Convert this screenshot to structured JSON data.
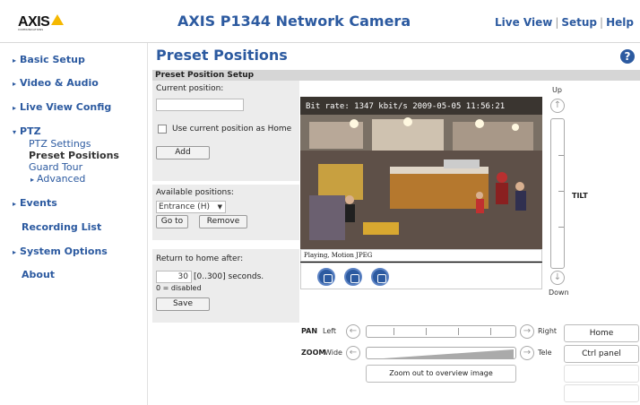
{
  "header": {
    "logo_text": "AXIS",
    "logo_sub": "COMMUNICATIONS",
    "title": "AXIS P1344 Network Camera",
    "links": [
      "Live View",
      "Setup",
      "Help"
    ],
    "sep": "|"
  },
  "sidebar": {
    "items": [
      {
        "label": "Basic Setup",
        "arrow": "▸"
      },
      {
        "label": "Video & Audio",
        "arrow": "▸"
      },
      {
        "label": "Live View Config",
        "arrow": "▸"
      },
      {
        "label": "PTZ",
        "arrow": "▾"
      },
      {
        "label": "Events",
        "arrow": "▸"
      },
      {
        "label": "Recording List",
        "arrow": ""
      },
      {
        "label": "System Options",
        "arrow": "▸"
      },
      {
        "label": "About",
        "arrow": ""
      }
    ],
    "ptz_sub": [
      "PTZ Settings",
      "Preset Positions",
      "Guard Tour",
      "Advanced"
    ],
    "advanced_arrow": "▸"
  },
  "main": {
    "title": "Preset Positions",
    "help": "?",
    "section": "Preset Position Setup",
    "current_label": "Current position:",
    "current_value": "",
    "use_home_label": "Use current position as Home",
    "add_btn": "Add",
    "available_label": "Available positions:",
    "available_selected": "Entrance (H)",
    "goto_btn": "Go to",
    "remove_btn": "Remove",
    "return_label": "Return to home after:",
    "return_value": "30",
    "return_range": "[0..300] seconds.",
    "disabled_note": "0 = disabled",
    "save_btn": "Save"
  },
  "video": {
    "overlay": "Bit rate:  1347 kbit/s 2009-05-05 11:56:21",
    "status": "Playing, Motion JPEG"
  },
  "ptz": {
    "up": "Up",
    "down": "Down",
    "tilt": "TILT",
    "pan": "PAN",
    "left": "Left",
    "right": "Right",
    "zoom": "ZOOM",
    "wide": "Wide",
    "tele": "Tele",
    "home_btn": "Home",
    "ctrl_btn": "Ctrl panel",
    "overview_btn": "Zoom out to overview image"
  }
}
